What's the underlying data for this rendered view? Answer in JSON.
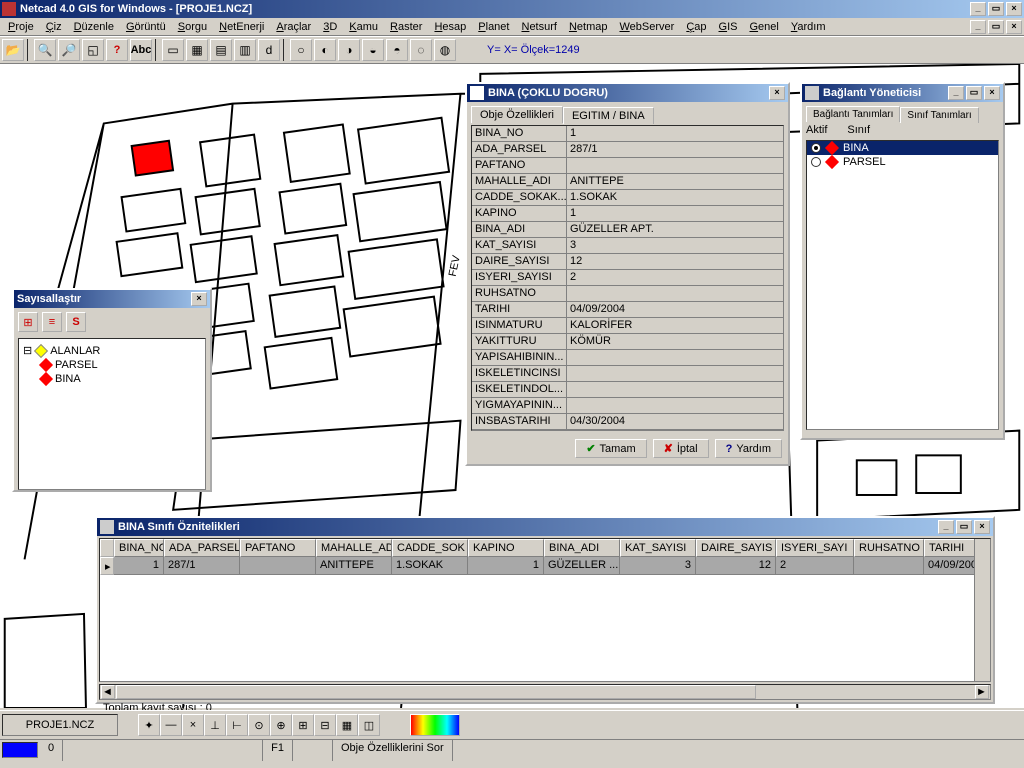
{
  "app": {
    "title": "Netcad 4.0 GIS for Windows - [PROJE1.NCZ]"
  },
  "menu": [
    "Proje",
    "Çiz",
    "Düzenle",
    "Görüntü",
    "Sorgu",
    "NetEnerji",
    "Araçlar",
    "3D",
    "Kamu",
    "Raster",
    "Hesap",
    "Planet",
    "Netsurf",
    "Netmap",
    "WebServer",
    "Çap",
    "GIS",
    "Genel",
    "Yardım"
  ],
  "coords": "Y=    X=  Ölçek=1249",
  "digitize": {
    "title": "Sayısallaştır",
    "root": "ALANLAR",
    "s_btn": "S",
    "items": [
      "PARSEL",
      "BINA"
    ]
  },
  "attr": {
    "title": "BINA (ÇOKLU DOGRU)",
    "tabs": [
      "Obje Özellikleri",
      "EGITIM / BINA"
    ],
    "rows": [
      {
        "k": "BINA_NO",
        "v": "1"
      },
      {
        "k": "ADA_PARSEL",
        "v": "287/1"
      },
      {
        "k": "PAFTANO",
        "v": ""
      },
      {
        "k": "MAHALLE_ADI",
        "v": "ANITTEPE"
      },
      {
        "k": "CADDE_SOKAK...",
        "v": "1.SOKAK"
      },
      {
        "k": "KAPINO",
        "v": "1"
      },
      {
        "k": "BINA_ADI",
        "v": "GÜZELLER APT."
      },
      {
        "k": "KAT_SAYISI",
        "v": "3"
      },
      {
        "k": "DAIRE_SAYISI",
        "v": "12"
      },
      {
        "k": "ISYERI_SAYISI",
        "v": "2"
      },
      {
        "k": "RUHSATNO",
        "v": ""
      },
      {
        "k": "TARIHI",
        "v": "04/09/2004"
      },
      {
        "k": "ISINMATURU",
        "v": "KALORİFER"
      },
      {
        "k": "YAKITTURU",
        "v": "KÖMÜR"
      },
      {
        "k": "YAPISAHIBININ...",
        "v": ""
      },
      {
        "k": "ISKELETINCINSI",
        "v": ""
      },
      {
        "k": "ISKELETINDOL...",
        "v": ""
      },
      {
        "k": "YIGMAYAPININ...",
        "v": ""
      },
      {
        "k": "INSBASTARIHI",
        "v": "04/30/2004"
      }
    ],
    "ok": "Tamam",
    "cancel": "İptal",
    "help": "Yardım"
  },
  "conn": {
    "title": "Bağlantı Yöneticisi",
    "tabs": [
      "Bağlantı Tanımları",
      "Sınıf Tanımları"
    ],
    "hdr": [
      "Aktif",
      "Sınıf"
    ],
    "items": [
      {
        "name": "BINA",
        "on": true,
        "sel": true
      },
      {
        "name": "PARSEL",
        "on": false,
        "sel": false
      }
    ]
  },
  "grid": {
    "title": "BINA Sınıfı Öznitelikleri",
    "cols": [
      "BINA_NO",
      "ADA_PARSEL",
      "PAFTANO",
      "MAHALLE_AD",
      "CADDE_SOK",
      "KAPINO",
      "BINA_ADI",
      "KAT_SAYISI",
      "DAIRE_SAYIS",
      "ISYERI_SAYI",
      "RUHSATNO",
      "TARIHI"
    ],
    "row": [
      "1",
      "287/1",
      "",
      "ANITTEPE",
      "1.SOKAK",
      "1",
      "GÜZELLER ...",
      "3",
      "12",
      "2",
      "",
      "04/09/2004"
    ],
    "footer": "Toplam kayıt sayısı : 0"
  },
  "status": {
    "file": "PROJE1.NCZ",
    "f1": "F1",
    "msg": "Obje Özelliklerini Sor",
    "zero": "0"
  }
}
